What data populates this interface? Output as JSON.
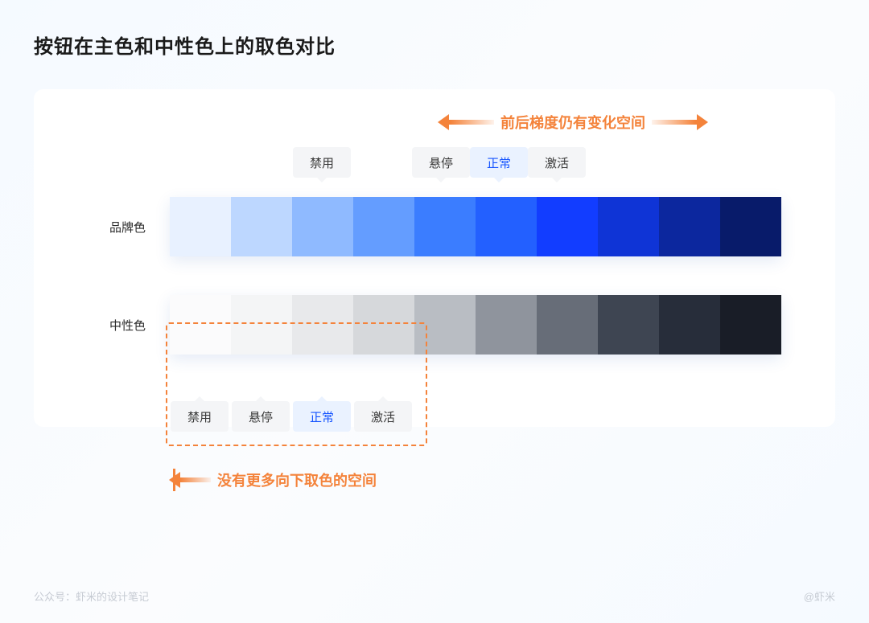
{
  "title": "按钮在主色和中性色上的取色对比",
  "rows": {
    "brand_label": "品牌色",
    "neutral_label": "中性色"
  },
  "states": {
    "disabled": "禁用",
    "hover": "悬停",
    "normal": "正常",
    "active": "激活"
  },
  "annotations": {
    "top": "前后梯度仍有变化空间",
    "bottom": "没有更多向下取色的空间"
  },
  "footer": {
    "left": "公众号：虾米的设计笔记",
    "right": "@虾米"
  },
  "chart_data": {
    "type": "table",
    "title": "按钮在主色和中性色上的取色对比",
    "brand_colors": [
      "#e8f1ff",
      "#bdd7ff",
      "#8fbaff",
      "#649dff",
      "#3b7dff",
      "#2360ff",
      "#123dff",
      "#0f34d6",
      "#0c279e",
      "#081b6a"
    ],
    "neutral_colors": [
      "#fbfbfc",
      "#f4f5f6",
      "#e8e9eb",
      "#d6d8db",
      "#b9bdc3",
      "#8f949d",
      "#676d78",
      "#3e4552",
      "#272d3a",
      "#191d27"
    ],
    "brand_state_indices": {
      "disabled": 2,
      "hover": 4,
      "normal": 5,
      "active": 6
    },
    "neutral_state_indices": {
      "disabled": 0,
      "hover": 1,
      "normal": 2,
      "active": 3
    }
  }
}
